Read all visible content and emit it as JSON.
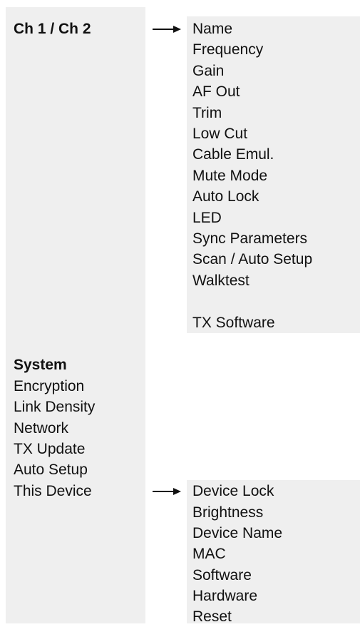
{
  "channel_section": {
    "heading": "Ch 1 / Ch 2",
    "submenu": [
      "Name",
      "Frequency",
      "Gain",
      "AF Out",
      "Trim",
      "Low Cut",
      "Cable Emul.",
      "Mute Mode",
      "Auto Lock",
      "LED",
      "Sync Parameters",
      "Scan / Auto Setup",
      "Walktest",
      "TX Software"
    ]
  },
  "system_section": {
    "heading": "System",
    "items": [
      "Encryption",
      "Link Density",
      "Network",
      "TX Update",
      "Auto Setup",
      "This Device"
    ],
    "device_submenu": [
      "Device Lock",
      "Brightness",
      "Device Name",
      "MAC",
      "Software",
      "Hardware",
      "Reset"
    ]
  },
  "colors": {
    "panel_background": "#efefef",
    "text": "#111111",
    "arrow": "#111111"
  },
  "icons": {
    "arrow": "arrow-right-icon"
  }
}
